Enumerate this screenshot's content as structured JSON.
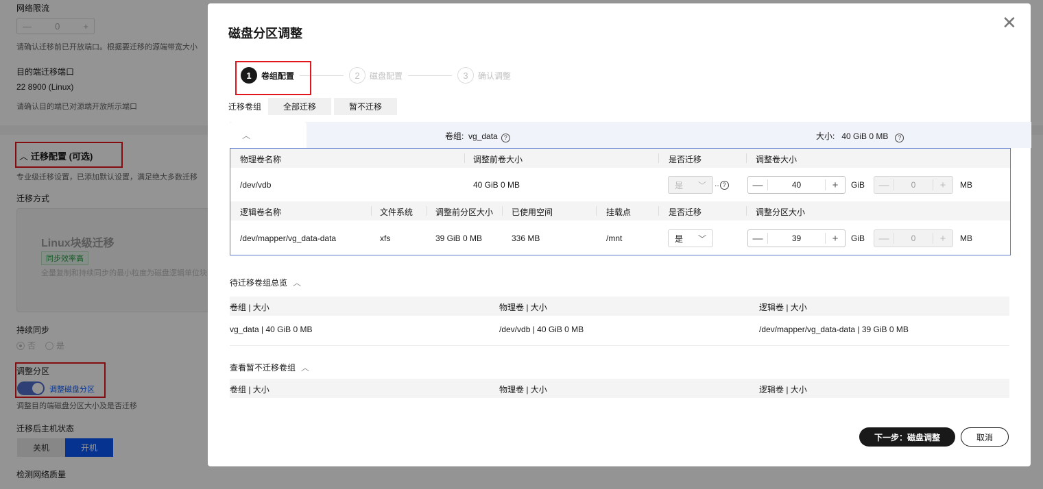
{
  "background": {
    "network_limit_label": "网络限流",
    "network_limit_value": "0",
    "port_hint": "请确认迁移前已开放端口。根据要迁移的源端带宽大小",
    "dest_port_label": "目的端迁移端口",
    "dest_port_value": "22 8900 (Linux)",
    "dest_port_hint": "请确认目的端已对源端开放所示端口",
    "section_title": "迁移配置 (可选)",
    "section_hint": "专业级迁移设置，已添加默认设置，满足绝大多数迁移",
    "method_label": "迁移方式",
    "method_card_title": "Linux块级迁移",
    "method_card_badge": "同步效率高",
    "method_card_desc": "全量复制和持续同步的最小粒度为磁盘逻辑单位块",
    "sync_label": "持续同步",
    "radio_no": "否",
    "radio_yes": "是",
    "partition_label": "调整分区",
    "partition_toggle_label": "调整磁盘分区",
    "partition_hint": "调整目的端磁盘分区大小及是否迁移",
    "host_state_label": "迁移后主机状态",
    "host_off": "关机",
    "host_on": "开机",
    "network_quality_label": "检测网络质量"
  },
  "modal": {
    "title": "磁盘分区调整",
    "steps": [
      {
        "num": "1",
        "label": "卷组配置"
      },
      {
        "num": "2",
        "label": "磁盘配置"
      },
      {
        "num": "3",
        "label": "确认调整"
      }
    ],
    "tabs_label": "迁移卷组",
    "tab_all": "全部迁移",
    "tab_none": "暂不迁移",
    "vg_label": "卷组:",
    "vg_name": "vg_data",
    "size_label": "大小:",
    "size_value": "40 GiB 0 MB",
    "pv_headers": {
      "name": "物理卷名称",
      "before": "调整前卷大小",
      "migrate": "是否迁移",
      "adjust": "调整卷大小"
    },
    "pv_row": {
      "name": "/dev/vdb",
      "before": "40 GiB 0 MB",
      "migrate": "是",
      "gib": "40",
      "mb": "0"
    },
    "lv_headers": {
      "name": "逻辑卷名称",
      "fs": "文件系统",
      "before": "调整前分区大小",
      "used": "已使用空间",
      "mount": "挂载点",
      "migrate": "是否迁移",
      "adjust": "调整分区大小"
    },
    "lv_row": {
      "name": "/dev/mapper/vg_data-data",
      "fs": "xfs",
      "before": "39 GiB 0 MB",
      "used": "336 MB",
      "mount": "/mnt",
      "migrate": "是",
      "gib": "39",
      "mb": "0"
    },
    "unit_gib": "GiB",
    "unit_mb": "MB",
    "summary_title": "待迁移卷组总览",
    "summary_headers": [
      "卷组 | 大小",
      "物理卷 | 大小",
      "逻辑卷 | 大小"
    ],
    "summary_row": [
      "vg_data | 40 GiB 0 MB",
      "/dev/vdb | 40 GiB 0 MB",
      "/dev/mapper/vg_data-data | 39 GiB 0 MB"
    ],
    "excluded_title": "查看暂不迁移卷组",
    "excluded_headers": [
      "卷组 | 大小",
      "物理卷 | 大小",
      "逻辑卷 | 大小"
    ],
    "next_button": "下一步：磁盘调整",
    "cancel_button": "取消"
  }
}
